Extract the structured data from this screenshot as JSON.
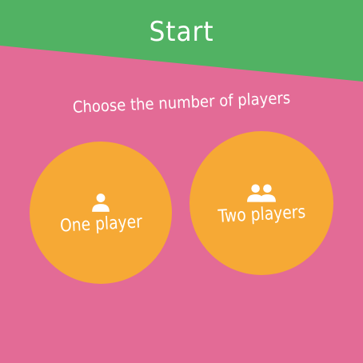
{
  "header": {
    "title": "Start"
  },
  "prompt": "Choose the number of players",
  "options": [
    {
      "label": "One player",
      "icon": "person-icon"
    },
    {
      "label": "Two players",
      "icon": "people-icon"
    }
  ],
  "colors": {
    "background": "#e36b96",
    "header": "#51b263",
    "button": "#f6a935",
    "text": "#ffffff"
  }
}
